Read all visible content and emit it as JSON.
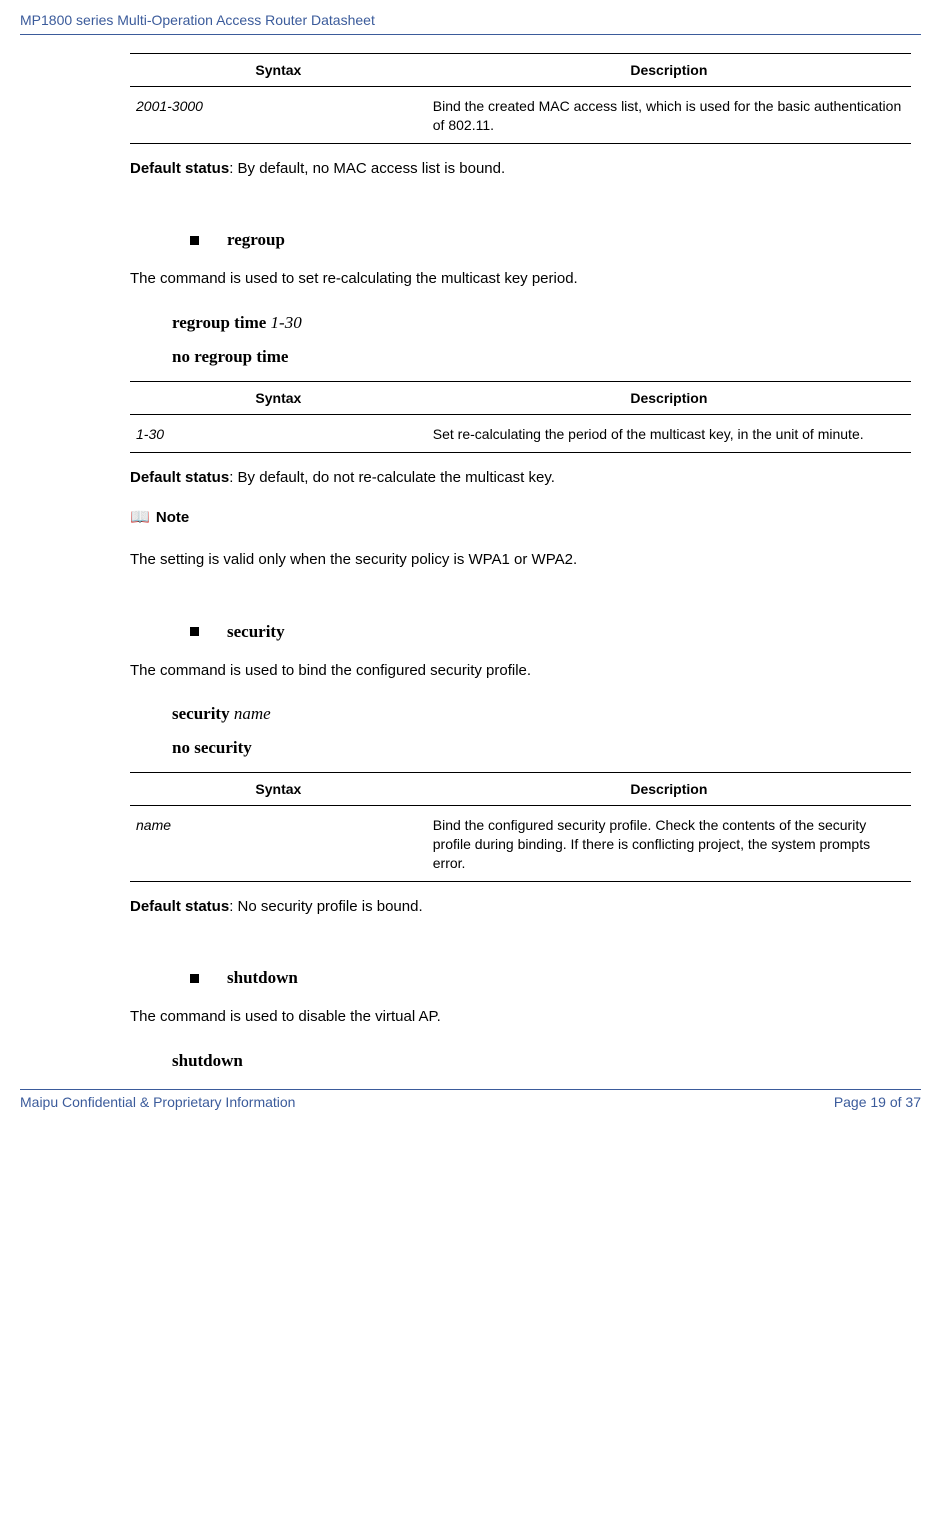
{
  "header_title": "MP1800 series Multi-Operation Access Router Datasheet",
  "table1": {
    "h1": "Syntax",
    "h2": "Description",
    "r1c1": "2001-3000",
    "r1c2": "Bind the created MAC access list, which is used for the basic authentication of 802.11."
  },
  "default1_label": "Default status",
  "default1_text": ": By default, no MAC access list is bound.",
  "section_regroup": {
    "title": "regroup",
    "intro": "The command is used to set re-calculating the multicast key period.",
    "syntax1_kw": "regroup time ",
    "syntax1_arg": "1-30",
    "syntax2_kw": "no regroup time"
  },
  "table2": {
    "h1": "Syntax",
    "h2": "Description",
    "r1c1": "1-30",
    "r1c2": "Set re-calculating the period of the multicast key, in the unit of minute."
  },
  "default2_label": "Default status",
  "default2_text": ": By default, do not re-calculate the multicast key.",
  "note_label": "Note",
  "note_text": "The setting is valid only when the security policy is WPA1 or WPA2.",
  "section_security": {
    "title": "security",
    "intro": "The command is used to bind the configured security profile.",
    "syntax1_kw": "security ",
    "syntax1_arg": "name",
    "syntax2_kw": "no security"
  },
  "table3": {
    "h1": "Syntax",
    "h2": "Description",
    "r1c1": "name",
    "r1c2": "Bind the configured security profile. Check the contents of the security profile during binding. If there is conflicting project, the system prompts error."
  },
  "default3_label": "Default status",
  "default3_text": ": No security profile is bound.",
  "section_shutdown": {
    "title": "shutdown",
    "intro": "The command is used to disable the virtual AP.",
    "syntax1_kw": "shutdown"
  },
  "footer_left": "Maipu Confidential & Proprietary Information",
  "footer_right": "Page 19 of 37"
}
